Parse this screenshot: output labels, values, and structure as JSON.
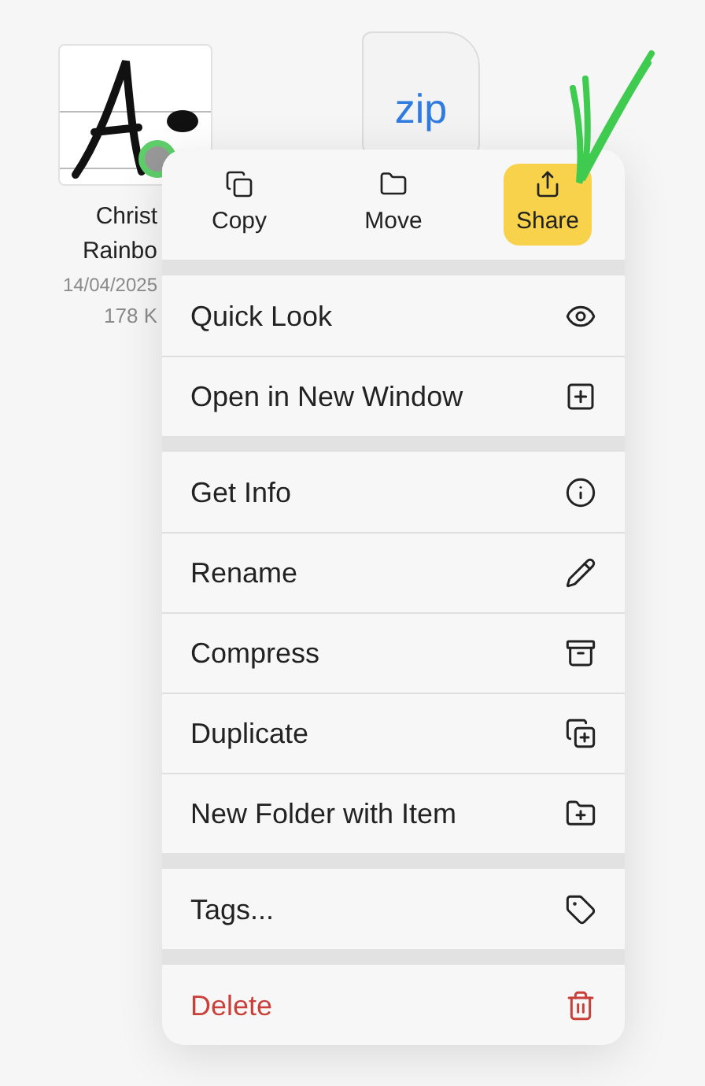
{
  "files": [
    {
      "name_lines": [
        "Christ",
        "Rainbo"
      ],
      "date": "14/04/2025",
      "size": "178 K"
    },
    {
      "kind": "zip",
      "label": "zip"
    }
  ],
  "menu": {
    "actions": [
      {
        "label": "Copy",
        "highlighted": false
      },
      {
        "label": "Move",
        "highlighted": false
      },
      {
        "label": "Share",
        "highlighted": true
      }
    ],
    "groups": [
      [
        {
          "label": "Quick Look",
          "kind": "normal"
        },
        {
          "label": "Open in New Window",
          "kind": "normal"
        }
      ],
      [
        {
          "label": "Get Info",
          "kind": "normal"
        },
        {
          "label": "Rename",
          "kind": "normal"
        },
        {
          "label": "Compress",
          "kind": "normal"
        },
        {
          "label": "Duplicate",
          "kind": "normal"
        },
        {
          "label": "New Folder with Item",
          "kind": "normal"
        }
      ],
      [
        {
          "label": "Tags...",
          "kind": "normal"
        }
      ],
      [
        {
          "label": "Delete",
          "kind": "destructive"
        }
      ]
    ]
  }
}
